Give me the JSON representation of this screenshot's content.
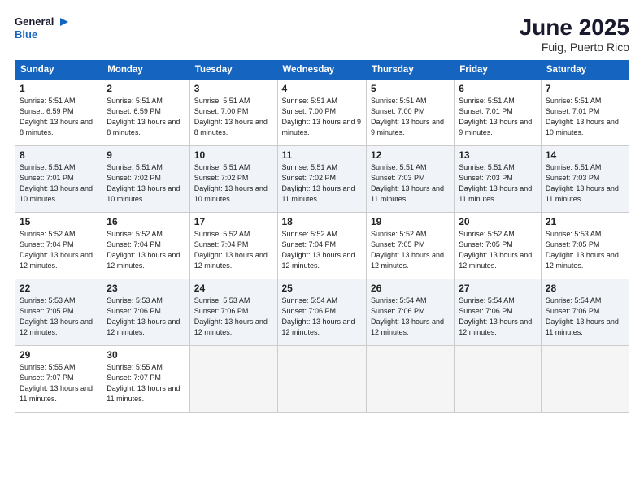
{
  "logo": {
    "general": "General",
    "blue": "Blue"
  },
  "title": "June 2025",
  "subtitle": "Fuig, Puerto Rico",
  "days_header": [
    "Sunday",
    "Monday",
    "Tuesday",
    "Wednesday",
    "Thursday",
    "Friday",
    "Saturday"
  ],
  "weeks": [
    [
      {
        "num": "1",
        "sunrise": "5:51 AM",
        "sunset": "6:59 PM",
        "daylight": "13 hours and 8 minutes."
      },
      {
        "num": "2",
        "sunrise": "5:51 AM",
        "sunset": "6:59 PM",
        "daylight": "13 hours and 8 minutes."
      },
      {
        "num": "3",
        "sunrise": "5:51 AM",
        "sunset": "7:00 PM",
        "daylight": "13 hours and 8 minutes."
      },
      {
        "num": "4",
        "sunrise": "5:51 AM",
        "sunset": "7:00 PM",
        "daylight": "13 hours and 9 minutes."
      },
      {
        "num": "5",
        "sunrise": "5:51 AM",
        "sunset": "7:00 PM",
        "daylight": "13 hours and 9 minutes."
      },
      {
        "num": "6",
        "sunrise": "5:51 AM",
        "sunset": "7:01 PM",
        "daylight": "13 hours and 9 minutes."
      },
      {
        "num": "7",
        "sunrise": "5:51 AM",
        "sunset": "7:01 PM",
        "daylight": "13 hours and 10 minutes."
      }
    ],
    [
      {
        "num": "8",
        "sunrise": "5:51 AM",
        "sunset": "7:01 PM",
        "daylight": "13 hours and 10 minutes."
      },
      {
        "num": "9",
        "sunrise": "5:51 AM",
        "sunset": "7:02 PM",
        "daylight": "13 hours and 10 minutes."
      },
      {
        "num": "10",
        "sunrise": "5:51 AM",
        "sunset": "7:02 PM",
        "daylight": "13 hours and 10 minutes."
      },
      {
        "num": "11",
        "sunrise": "5:51 AM",
        "sunset": "7:02 PM",
        "daylight": "13 hours and 11 minutes."
      },
      {
        "num": "12",
        "sunrise": "5:51 AM",
        "sunset": "7:03 PM",
        "daylight": "13 hours and 11 minutes."
      },
      {
        "num": "13",
        "sunrise": "5:51 AM",
        "sunset": "7:03 PM",
        "daylight": "13 hours and 11 minutes."
      },
      {
        "num": "14",
        "sunrise": "5:51 AM",
        "sunset": "7:03 PM",
        "daylight": "13 hours and 11 minutes."
      }
    ],
    [
      {
        "num": "15",
        "sunrise": "5:52 AM",
        "sunset": "7:04 PM",
        "daylight": "13 hours and 12 minutes."
      },
      {
        "num": "16",
        "sunrise": "5:52 AM",
        "sunset": "7:04 PM",
        "daylight": "13 hours and 12 minutes."
      },
      {
        "num": "17",
        "sunrise": "5:52 AM",
        "sunset": "7:04 PM",
        "daylight": "13 hours and 12 minutes."
      },
      {
        "num": "18",
        "sunrise": "5:52 AM",
        "sunset": "7:04 PM",
        "daylight": "13 hours and 12 minutes."
      },
      {
        "num": "19",
        "sunrise": "5:52 AM",
        "sunset": "7:05 PM",
        "daylight": "13 hours and 12 minutes."
      },
      {
        "num": "20",
        "sunrise": "5:52 AM",
        "sunset": "7:05 PM",
        "daylight": "13 hours and 12 minutes."
      },
      {
        "num": "21",
        "sunrise": "5:53 AM",
        "sunset": "7:05 PM",
        "daylight": "13 hours and 12 minutes."
      }
    ],
    [
      {
        "num": "22",
        "sunrise": "5:53 AM",
        "sunset": "7:05 PM",
        "daylight": "13 hours and 12 minutes."
      },
      {
        "num": "23",
        "sunrise": "5:53 AM",
        "sunset": "7:06 PM",
        "daylight": "13 hours and 12 minutes."
      },
      {
        "num": "24",
        "sunrise": "5:53 AM",
        "sunset": "7:06 PM",
        "daylight": "13 hours and 12 minutes."
      },
      {
        "num": "25",
        "sunrise": "5:54 AM",
        "sunset": "7:06 PM",
        "daylight": "13 hours and 12 minutes."
      },
      {
        "num": "26",
        "sunrise": "5:54 AM",
        "sunset": "7:06 PM",
        "daylight": "13 hours and 12 minutes."
      },
      {
        "num": "27",
        "sunrise": "5:54 AM",
        "sunset": "7:06 PM",
        "daylight": "13 hours and 12 minutes."
      },
      {
        "num": "28",
        "sunrise": "5:54 AM",
        "sunset": "7:06 PM",
        "daylight": "13 hours and 11 minutes."
      }
    ],
    [
      {
        "num": "29",
        "sunrise": "5:55 AM",
        "sunset": "7:07 PM",
        "daylight": "13 hours and 11 minutes."
      },
      {
        "num": "30",
        "sunrise": "5:55 AM",
        "sunset": "7:07 PM",
        "daylight": "13 hours and 11 minutes."
      },
      null,
      null,
      null,
      null,
      null
    ]
  ],
  "labels": {
    "sunrise": "Sunrise:",
    "sunset": "Sunset:",
    "daylight": "Daylight:"
  }
}
